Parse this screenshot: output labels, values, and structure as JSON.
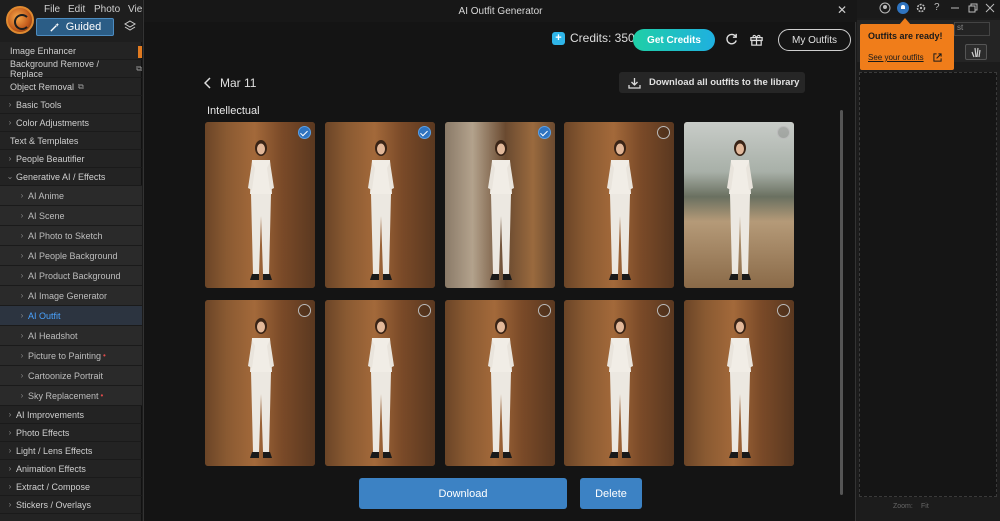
{
  "menu": [
    "File",
    "Edit",
    "Photo",
    "View"
  ],
  "mode": {
    "label": "Guided"
  },
  "left_panel": {
    "items": [
      {
        "label": "Image Enhancer",
        "type": "plain"
      },
      {
        "label": "Background Remove / Replace",
        "type": "plain",
        "ext": true
      },
      {
        "label": "Object Removal",
        "type": "plain",
        "ext": true
      },
      {
        "label": "Basic Tools",
        "type": "group"
      },
      {
        "label": "Color Adjustments",
        "type": "group"
      },
      {
        "label": "Text & Templates",
        "type": "plain"
      },
      {
        "label": "People Beautifier",
        "type": "group"
      },
      {
        "label": "Generative AI / Effects",
        "type": "group-open"
      },
      {
        "label": "AI Anime",
        "type": "sub"
      },
      {
        "label": "AI Scene",
        "type": "sub"
      },
      {
        "label": "AI Photo to Sketch",
        "type": "sub"
      },
      {
        "label": "AI People Background",
        "type": "sub"
      },
      {
        "label": "AI Product Background",
        "type": "sub"
      },
      {
        "label": "AI Image Generator",
        "type": "sub"
      },
      {
        "label": "AI Outfit",
        "type": "sub",
        "active": true
      },
      {
        "label": "AI Headshot",
        "type": "sub"
      },
      {
        "label": "Picture to Painting",
        "type": "sub",
        "dot": true
      },
      {
        "label": "Cartoonize Portrait",
        "type": "sub"
      },
      {
        "label": "Sky Replacement",
        "type": "sub",
        "dot": true
      },
      {
        "label": "AI Improvements",
        "type": "group"
      },
      {
        "label": "Photo Effects",
        "type": "group"
      },
      {
        "label": "Light / Lens Effects",
        "type": "group"
      },
      {
        "label": "Animation Effects",
        "type": "group"
      },
      {
        "label": "Extract / Compose",
        "type": "group"
      },
      {
        "label": "Stickers / Overlays",
        "type": "group"
      }
    ]
  },
  "modal": {
    "title": "AI Outfit Generator",
    "credits_label": "Credits: 350",
    "get_credits": "Get Credits",
    "my_outfits": "My Outfits",
    "date": "Mar 11",
    "download_all": "Download all outfits to the library",
    "group_label": "Intellectual",
    "photos": [
      {
        "selected": true,
        "bg": "door"
      },
      {
        "selected": true,
        "bg": "door"
      },
      {
        "selected": true,
        "bg": "column"
      },
      {
        "selected": false,
        "bg": "door"
      },
      {
        "selected": false,
        "bg": "outdoor"
      },
      {
        "selected": false,
        "bg": "door"
      },
      {
        "selected": false,
        "bg": "door"
      },
      {
        "selected": false,
        "bg": "door"
      },
      {
        "selected": false,
        "bg": "door"
      },
      {
        "selected": false,
        "bg": "door"
      }
    ],
    "download": "Download",
    "delete": "Delete"
  },
  "toast": {
    "title": "Outfits are ready!",
    "link": "See your outfits"
  },
  "right_panel": {
    "zoom_label": "Zoom:",
    "zoom_value": "Fit"
  },
  "colors": {
    "accent": "#3c82c4",
    "toast": "#f07d1a",
    "get_credits_start": "#1fcfa6",
    "get_credits_end": "#1fb0e0"
  }
}
